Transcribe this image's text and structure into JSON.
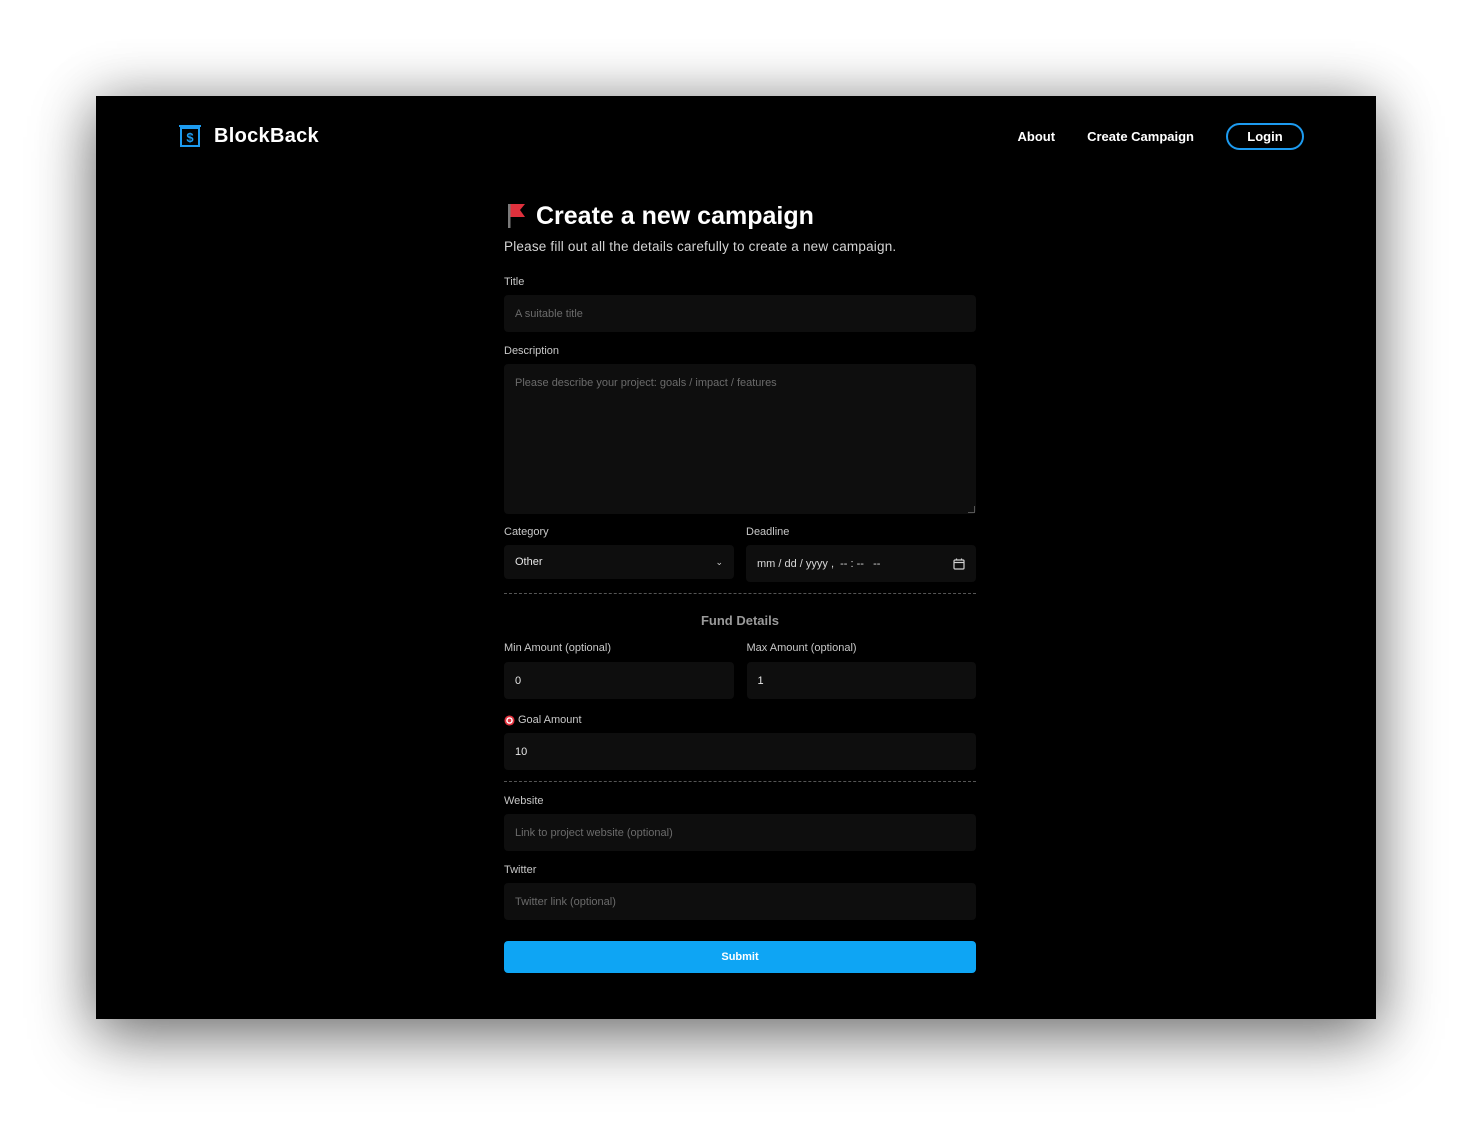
{
  "header": {
    "brand": "BlockBack",
    "nav": [
      "About",
      "Create Campaign"
    ],
    "login": "Login"
  },
  "form": {
    "heading": "Create a new campaign",
    "subheading": "Please fill out all the details carefully to create a new campaign.",
    "title": {
      "label": "Title",
      "placeholder": "A suitable title",
      "value": ""
    },
    "description": {
      "label": "Description",
      "placeholder": "Please describe your project: goals / impact / features",
      "value": ""
    },
    "category": {
      "label": "Category",
      "value": "Other"
    },
    "deadline": {
      "label": "Deadline",
      "value": "mm / dd / yyyy ,  -- : --   --"
    },
    "fund_section_title": "Fund Details",
    "min_amount": {
      "label": "Min Amount (optional)",
      "value": "0"
    },
    "max_amount": {
      "label": "Max Amount (optional)",
      "value": "1"
    },
    "goal_amount": {
      "label": "Goal Amount",
      "value": "10"
    },
    "website": {
      "label": "Website",
      "placeholder": "Link to project website (optional)",
      "value": ""
    },
    "twitter": {
      "label": "Twitter",
      "placeholder": "Twitter link (optional)",
      "value": ""
    },
    "submit": "Submit"
  },
  "colors": {
    "background": "#000000",
    "field_background": "#0e0e0e",
    "accent": "#0ea5f4",
    "login_border": "#1d9bf0",
    "logo": "#1d9bf0",
    "flag": "#e0313d"
  },
  "icons": {
    "logo": "dollar-document-icon",
    "heading": "red-flag-icon",
    "deadline": "calendar-icon",
    "category": "chevron-down-icon",
    "goal": "target-icon"
  }
}
